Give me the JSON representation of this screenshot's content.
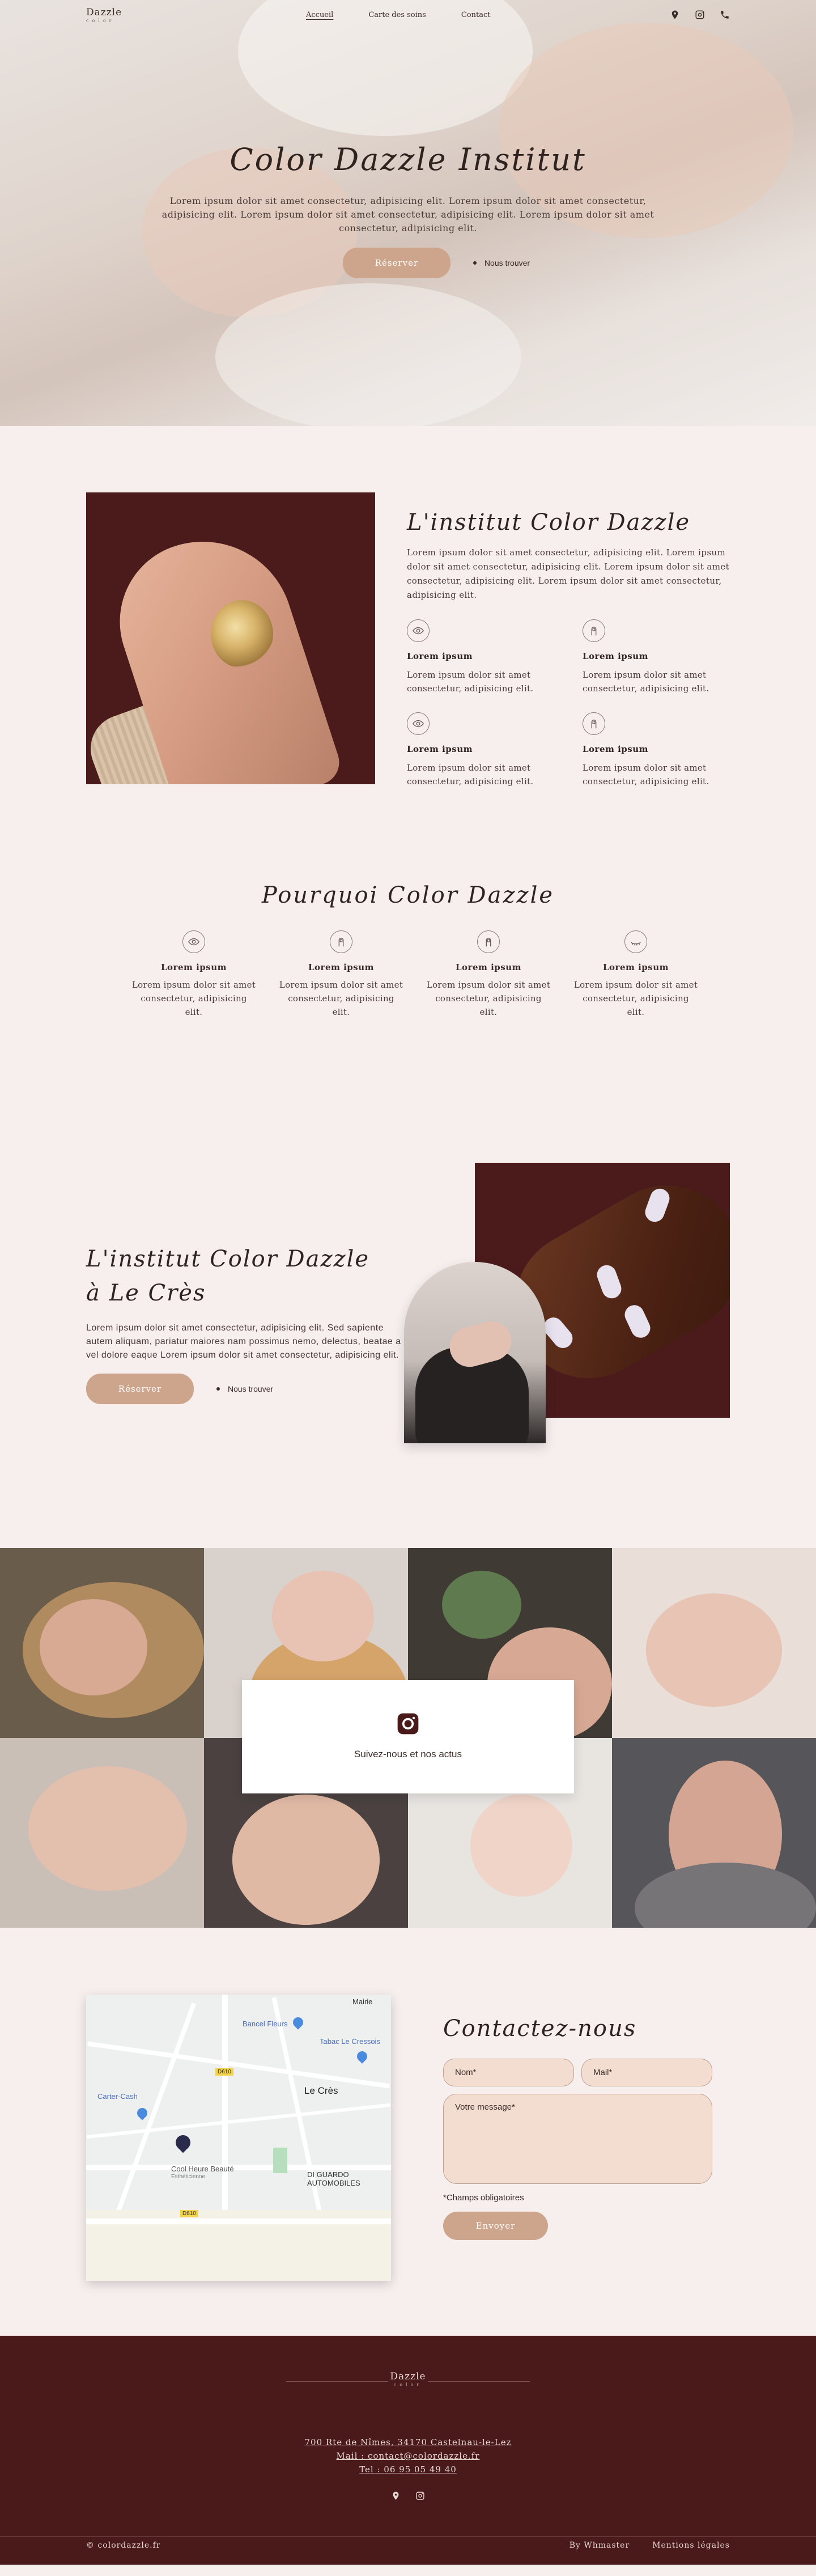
{
  "nav": {
    "logo_main": "Dazzle",
    "logo_sub": "color",
    "items": [
      {
        "label": "Accueil"
      },
      {
        "label": "Carte des soins"
      },
      {
        "label": "Contact"
      }
    ],
    "icons": [
      "location-icon",
      "instagram-icon",
      "phone-icon"
    ]
  },
  "hero": {
    "title": "Color Dazzle Institut",
    "text": "Lorem ipsum dolor sit amet consectetur, adipisicing elit. Lorem ipsum dolor sit amet consectetur, adipisicing elit. Lorem ipsum dolor sit amet consectetur, adipisicing elit. Lorem ipsum dolor sit amet consectetur, adipisicing elit.",
    "button": "Réserver",
    "link": "Nous trouver"
  },
  "about": {
    "title": "L'institut Color Dazzle",
    "intro": "Lorem ipsum dolor sit amet consectetur, adipisicing elit. Lorem ipsum dolor sit amet consectetur, adipisicing elit. Lorem ipsum dolor sit amet consectetur, adipisicing elit. Lorem ipsum dolor sit amet consectetur, adipisicing elit.",
    "features": [
      {
        "title": "Lorem ipsum",
        "text": "Lorem ipsum dolor sit amet consectetur, adipisicing elit.",
        "icon": "eye-icon"
      },
      {
        "title": "Lorem ipsum",
        "text": "Lorem ipsum dolor sit amet consectetur, adipisicing elit.",
        "icon": "nail-icon"
      },
      {
        "title": "Lorem ipsum",
        "text": "Lorem ipsum dolor sit amet consectetur, adipisicing elit.",
        "icon": "eye-icon"
      },
      {
        "title": "Lorem ipsum",
        "text": "Lorem ipsum dolor sit amet consectetur, adipisicing elit.",
        "icon": "nail-icon"
      }
    ]
  },
  "why": {
    "title": "Pourquoi Color Dazzle",
    "items": [
      {
        "title": "Lorem ipsum",
        "text": "Lorem ipsum dolor sit amet consectetur, adipisicing elit.",
        "icon": "eye-icon"
      },
      {
        "title": "Lorem ipsum",
        "text": "Lorem ipsum dolor sit amet consectetur, adipisicing elit.",
        "icon": "nail-icon"
      },
      {
        "title": "Lorem ipsum",
        "text": "Lorem ipsum dolor sit amet consectetur, adipisicing elit.",
        "icon": "nail-icon"
      },
      {
        "title": "Lorem ipsum",
        "text": "Lorem ipsum dolor sit amet consectetur, adipisicing elit.",
        "icon": "lash-icon"
      }
    ]
  },
  "institute": {
    "title_line1": "L'institut Color Dazzle",
    "title_line2": "à Le Crès",
    "text": "Lorem ipsum dolor sit amet consectetur, adipisicing elit. Sed sapiente autem aliquam, pariatur maiores nam possimus nemo, delectus, beatae a vel dolore eaque Lorem ipsum dolor sit amet consectetur, adipisicing elit.",
    "button": "Réserver",
    "link": "Nous trouver"
  },
  "instagram": {
    "text": "Suivez-nous et nos actus"
  },
  "map": {
    "labels": [
      "Bancel Fleurs",
      "Mairie",
      "Tabac Le Cressois",
      "Le Crès",
      "Carter-Cash",
      "Cool Heure Beauté",
      "Esthéticienne",
      "DI GUARDO AUTOMOBILES",
      "D610",
      "D610"
    ]
  },
  "contact": {
    "title": "Contactez-nous",
    "name_placeholder": "Nom*",
    "mail_placeholder": "Mail*",
    "message_placeholder": "Votre message*",
    "required_note": "*Champs obligatoires",
    "button": "Envoyer"
  },
  "footer": {
    "logo_main": "Dazzle",
    "logo_sub": "color",
    "address": "700 Rte de Nîmes, 34170 Castelnau-le-Lez",
    "mail": "Mail : contact@colordazzle.fr",
    "tel": "Tel : 06 95 05 49 40",
    "copyright": "© colordazzle.fr",
    "links": [
      "By Whmaster",
      "Mentions légales"
    ]
  },
  "colors": {
    "accent": "#cda58c",
    "burgundy": "#4a1a1b",
    "background": "#f7efee"
  }
}
